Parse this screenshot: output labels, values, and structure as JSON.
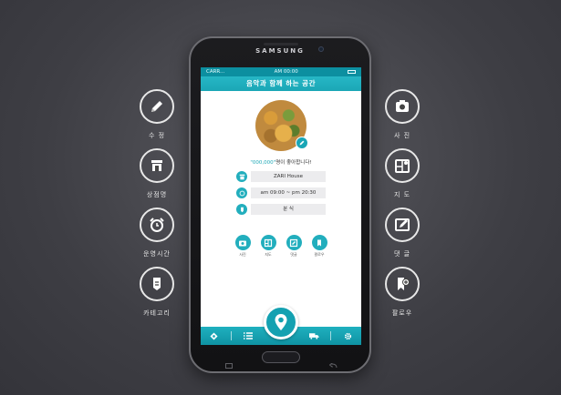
{
  "features_left": [
    {
      "label": "수 정",
      "icon": "pencil-icon"
    },
    {
      "label": "상점명",
      "icon": "shop-icon"
    },
    {
      "label": "운영시간",
      "icon": "alarm-clock-icon"
    },
    {
      "label": "카테고리",
      "icon": "category-tag-icon"
    }
  ],
  "features_right": [
    {
      "label": "사 진",
      "icon": "camera-icon"
    },
    {
      "label": "지 도",
      "icon": "map-icon"
    },
    {
      "label": "댓 글",
      "icon": "comment-edit-icon"
    },
    {
      "label": "팔로우",
      "icon": "follow-bookmark-icon"
    }
  ],
  "phone": {
    "brand": "SAMSUNG",
    "status_carrier": "CARR...",
    "status_time": "AM 00:00",
    "title": "음악과 함께 하는 공간",
    "likes_count": "\"000,000\"",
    "likes_text": "명이 좋아합니다!",
    "store_name": "ZARI House",
    "hours": "am 09:00 ~ pm 20:30",
    "category": "분 식",
    "actions": [
      {
        "label": "사진",
        "icon": "camera-icon"
      },
      {
        "label": "지도",
        "icon": "map-icon"
      },
      {
        "label": "댓글",
        "icon": "comment-edit-icon"
      },
      {
        "label": "팔로우",
        "icon": "follow-bookmark-icon"
      }
    ]
  },
  "colors": {
    "accent": "#1ba7b6",
    "background": "#3e3e44"
  }
}
